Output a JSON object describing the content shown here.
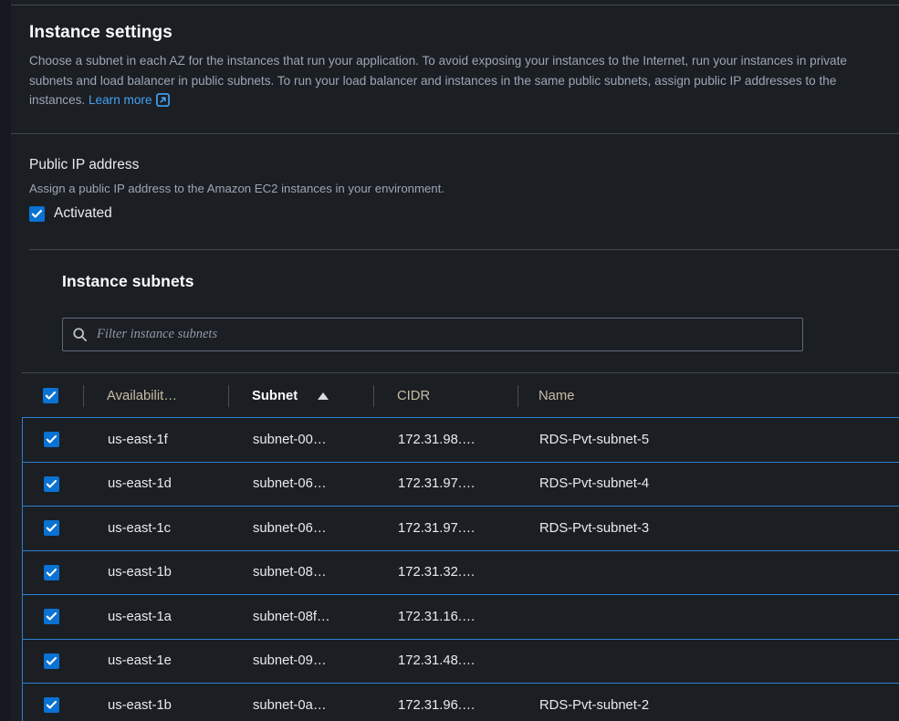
{
  "section": {
    "title": "Instance settings",
    "description": "Choose a subnet in each AZ for the instances that run your application. To avoid exposing your instances to the Internet, run your instances in private subnets and load balancer in public subnets. To run your load balancer and instances in the same public subnets, assign public IP addresses to the instances.",
    "learn_more_label": "Learn more",
    "learn_more_icon": "external-link-icon"
  },
  "public_ip": {
    "label": "Public IP address",
    "description": "Assign a public IP address to the Amazon EC2 instances in your environment.",
    "checkbox_label": "Activated",
    "checked": true
  },
  "subnets_card": {
    "title": "Instance subnets",
    "search": {
      "placeholder": "Filter instance subnets",
      "value": "",
      "icon": "search-icon"
    },
    "table": {
      "select_all_checked": true,
      "sort_column": "Subnet",
      "sort_direction": "ascending",
      "sort_icon": "caret-up-icon",
      "columns": [
        {
          "key": "az",
          "label": "Availabilit…",
          "sorted": false
        },
        {
          "key": "subnet",
          "label": "Subnet",
          "sorted": true
        },
        {
          "key": "cidr",
          "label": "CIDR",
          "sorted": false
        },
        {
          "key": "name",
          "label": "Name",
          "sorted": false
        }
      ],
      "rows": [
        {
          "selected": true,
          "az": "us-east-1f",
          "subnet": "subnet-00…",
          "cidr": "172.31.98.…",
          "name": "RDS-Pvt-subnet-5"
        },
        {
          "selected": true,
          "az": "us-east-1d",
          "subnet": "subnet-06…",
          "cidr": "172.31.97.…",
          "name": "RDS-Pvt-subnet-4"
        },
        {
          "selected": true,
          "az": "us-east-1c",
          "subnet": "subnet-06…",
          "cidr": "172.31.97.…",
          "name": "RDS-Pvt-subnet-3"
        },
        {
          "selected": true,
          "az": "us-east-1b",
          "subnet": "subnet-08…",
          "cidr": "172.31.32.…",
          "name": ""
        },
        {
          "selected": true,
          "az": "us-east-1a",
          "subnet": "subnet-08f…",
          "cidr": "172.31.16.…",
          "name": ""
        },
        {
          "selected": true,
          "az": "us-east-1e",
          "subnet": "subnet-09…",
          "cidr": "172.31.48.…",
          "name": ""
        },
        {
          "selected": true,
          "az": "us-east-1b",
          "subnet": "subnet-0a…",
          "cidr": "172.31.96.…",
          "name": "RDS-Pvt-subnet-2"
        }
      ]
    }
  },
  "colors": {
    "page_background": "#16191f",
    "panel_background": "#1b1e23",
    "accent_blue": "#0972d3",
    "row_border_blue": "#2e7fd1",
    "link_blue": "#42a4f5",
    "header_text": "#c6bda4",
    "body_text": "#e9ebed",
    "muted_text": "#9ba7b6",
    "divider": "#414750"
  }
}
